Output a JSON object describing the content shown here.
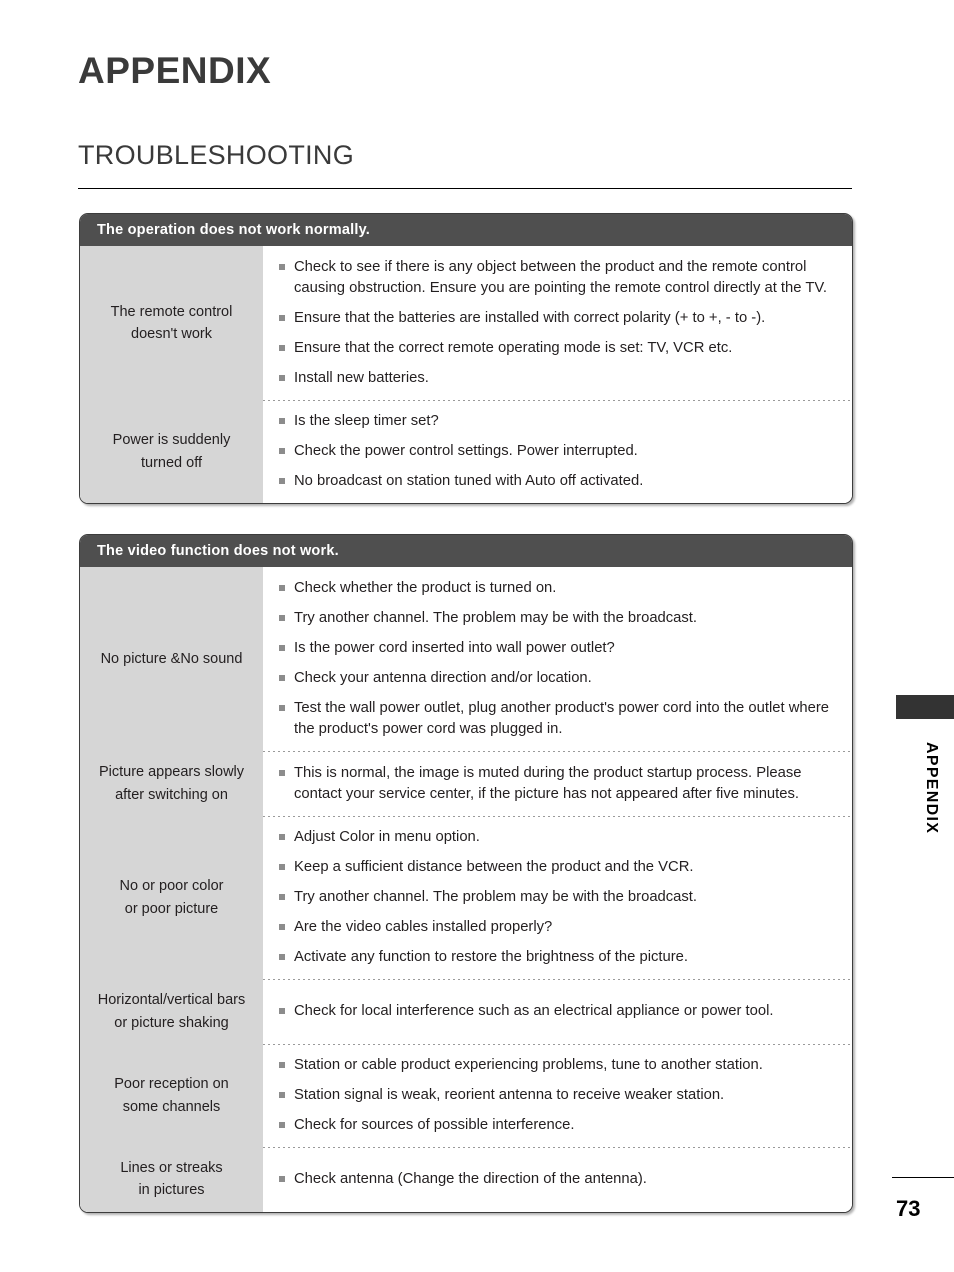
{
  "document": {
    "chapter_title": "APPENDIX",
    "section_title": "TROUBLESHOOTING",
    "page_number": "73",
    "side_tab_label": "APPENDIX",
    "bullet_glyph": "square-bullet",
    "colors": {
      "table_header_bg": "#4f4f4f",
      "table_header_text": "#ffffff",
      "label_column_bg": "#d6d6d6",
      "body_text": "#231f20",
      "bullet": "#8c8c8c",
      "table_border": "#3c3c3c",
      "side_tab": "#333333"
    }
  },
  "tables": [
    {
      "header": "The operation does not work normally.",
      "rows": [
        {
          "label_lines": [
            "The remote control",
            "doesn't work"
          ],
          "items": [
            "Check to see if there is any object between the product and the remote control causing obstruction. Ensure you are pointing the remote control directly at the TV.",
            "Ensure that the batteries are installed with correct polarity (+ to +, - to -).",
            "Ensure that the correct remote operating mode is set: TV, VCR etc.",
            "Install new batteries."
          ]
        },
        {
          "label_lines": [
            "Power is suddenly",
            "turned off"
          ],
          "items": [
            "Is the sleep timer set?",
            "Check the power control settings. Power interrupted.",
            "No broadcast on station tuned with Auto off activated."
          ]
        }
      ]
    },
    {
      "header": "The video function does not work.",
      "rows": [
        {
          "label_lines": [
            "No picture &No sound"
          ],
          "items": [
            "Check whether the product is turned on.",
            "Try another channel. The problem may be with the broadcast.",
            "Is the power cord inserted into wall power outlet?",
            "Check your antenna direction and/or location.",
            "Test the wall power outlet, plug another product's power cord into the outlet where the product's power cord was plugged in."
          ]
        },
        {
          "label_lines": [
            "Picture appears slowly",
            "after switching on"
          ],
          "items": [
            "This is normal, the image is muted during the product startup process. Please contact your service center, if the picture has not appeared after five minutes."
          ]
        },
        {
          "label_lines": [
            "No or poor color",
            "or poor picture"
          ],
          "items": [
            "Adjust Color in menu option.",
            "Keep a sufficient distance between the product and the VCR.",
            "Try another channel. The problem may be with the broadcast.",
            "Are the video cables installed properly?",
            "Activate any function to restore the brightness of the picture."
          ]
        },
        {
          "label_lines": [
            "Horizontal/vertical bars",
            "or picture shaking"
          ],
          "items": [
            "Check for local interference such as an electrical appliance or power tool."
          ]
        },
        {
          "label_lines": [
            "Poor reception on",
            "some channels"
          ],
          "items": [
            "Station or cable product experiencing problems, tune to another station.",
            "Station signal is weak, reorient antenna to receive weaker station.",
            "Check for sources of possible interference."
          ]
        },
        {
          "label_lines": [
            "Lines or streaks",
            "in pictures"
          ],
          "items": [
            "Check antenna (Change the direction of the antenna)."
          ]
        }
      ]
    }
  ]
}
